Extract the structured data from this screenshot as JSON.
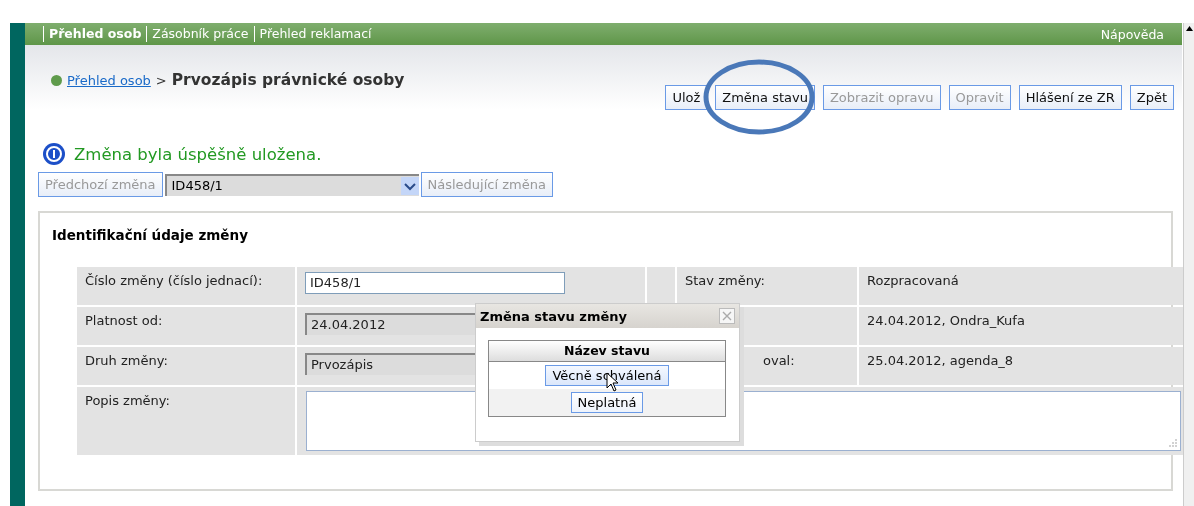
{
  "nav": {
    "items": [
      {
        "label": "Přehled osob",
        "selected": true
      },
      {
        "label": "Zásobník práce",
        "selected": false
      },
      {
        "label": "Přehled reklamací",
        "selected": false
      }
    ],
    "help": "Nápověda"
  },
  "breadcrumb": {
    "link": "Přehled osob",
    "separator": ">",
    "current": "Prvozápis právnické osoby"
  },
  "toolbar": [
    {
      "label": "Ulož",
      "disabled": false
    },
    {
      "label": "Změna stavu",
      "disabled": false
    },
    {
      "label": "Zobrazit opravu",
      "disabled": true
    },
    {
      "label": "Opravit",
      "disabled": true
    },
    {
      "label": "Hlášení ze ZR",
      "disabled": false
    },
    {
      "label": "Zpět",
      "disabled": false
    }
  ],
  "message": "Změna byla úspěšně uložena.",
  "change_nav": {
    "previous": {
      "label": "Předchozí změna",
      "disabled": true
    },
    "select": "ID458/1",
    "next": {
      "label": "Následující změna",
      "disabled": true
    }
  },
  "section_title": "Identifikační údaje změny",
  "form_rows": [
    {
      "label": "Číslo změny (číslo jednací):",
      "kind": "input",
      "value": "ID458/1",
      "right_label": "Stav změny:",
      "right_value": "Rozpracovaná"
    },
    {
      "label": "Platnost od:",
      "kind": "readonly",
      "value": "24.04.2012",
      "right_label": "",
      "right_value": "24.04.2012, Ondra_Kufa"
    },
    {
      "label": "Druh změny:",
      "kind": "readonly",
      "value": "Prvozápis",
      "right_label": "oval:",
      "right_value": "25.04.2012, agenda_8"
    },
    {
      "label": "Popis změny:",
      "kind": "textarea",
      "value": ""
    }
  ],
  "dialog": {
    "title": "Změna stavu změny",
    "column": "Název stavu",
    "options": [
      {
        "label": "Věcně schválená",
        "hovered": true
      },
      {
        "label": "Neplatná",
        "hovered": false
      }
    ]
  }
}
